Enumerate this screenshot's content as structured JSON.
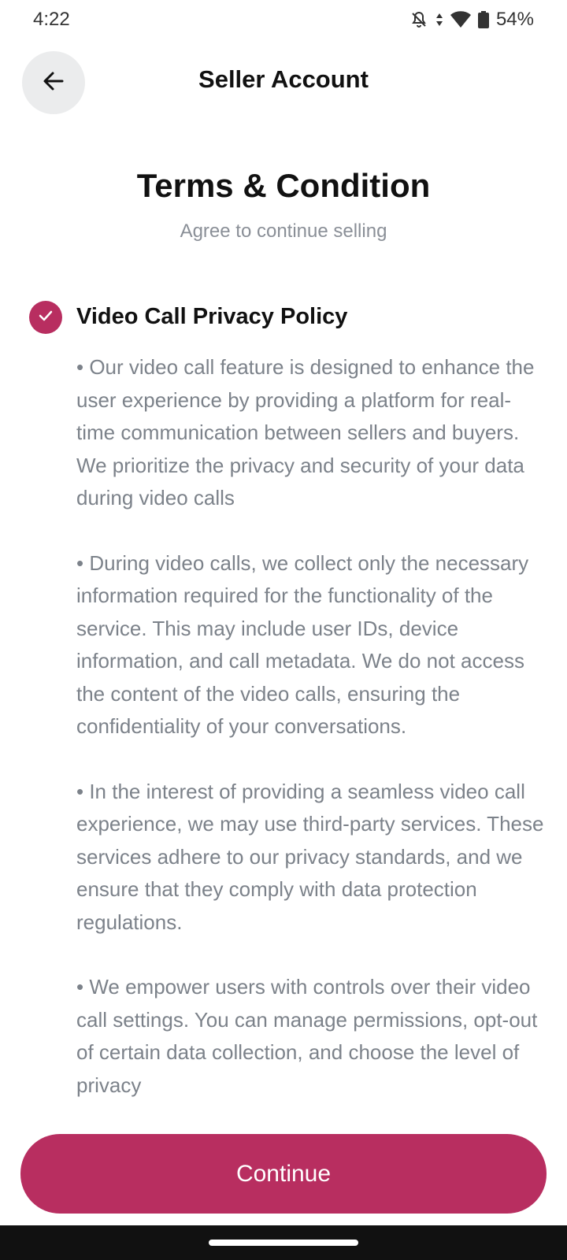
{
  "status_bar": {
    "time": "4:22",
    "battery": "54%",
    "icons": [
      "bell-off-icon",
      "data-arrows-icon",
      "wifi-icon",
      "battery-icon"
    ]
  },
  "header": {
    "title": "Seller Account",
    "back_icon": "arrow-left-icon"
  },
  "page": {
    "title": "Terms & Condition",
    "subtitle": "Agree to continue selling"
  },
  "policy": {
    "title": "Video Call Privacy Policy",
    "checked": true,
    "paragraphs": [
      "• Our video call feature is designed to enhance the user experience by providing a platform for real-time communication between sellers and buyers. We prioritize the privacy and security of your data during video calls",
      "• During video calls, we collect only the necessary information required for the functionality of the service. This may include user IDs, device information, and call metadata. We do not access the content of the video calls, ensuring the confidentiality of your conversations.",
      "• In the interest of providing a seamless video call experience, we may use third-party services. These services adhere to our privacy standards, and we ensure that they comply with data protection regulations.",
      "• We empower users with controls over their video call settings. You can manage permissions, opt-out of certain data collection, and choose the level of privacy"
    ]
  },
  "actions": {
    "continue_label": "Continue"
  },
  "colors": {
    "accent": "#b82e60",
    "body_text": "#7c828a",
    "subtitle_text": "#8a8f97",
    "back_button_bg": "#ebeced"
  }
}
